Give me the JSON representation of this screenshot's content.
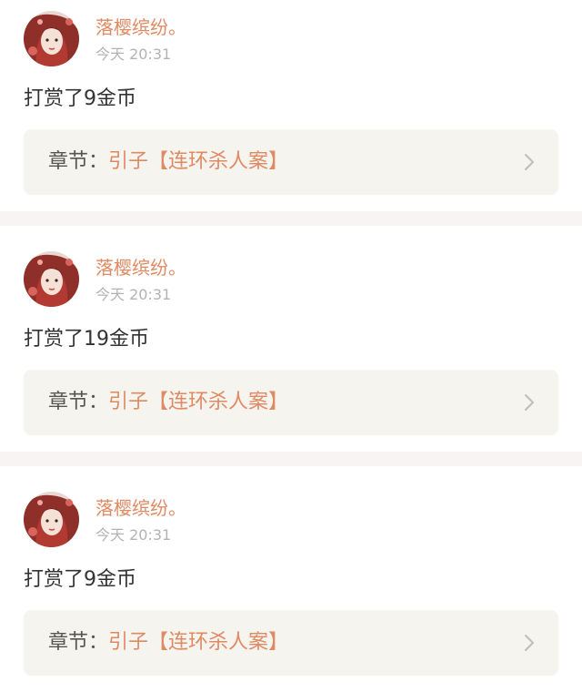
{
  "posts": [
    {
      "username": "落樱缤纷。",
      "time": "今天 20:31",
      "message": "打赏了9金币",
      "chapter_prefix": "章节：",
      "chapter_title": "引子【连环杀人案】"
    },
    {
      "username": "落樱缤纷。",
      "time": "今天 20:31",
      "message": "打赏了19金币",
      "chapter_prefix": "章节：",
      "chapter_title": "引子【连环杀人案】"
    },
    {
      "username": "落樱缤纷。",
      "time": "今天 20:31",
      "message": "打赏了9金币",
      "chapter_prefix": "章节：",
      "chapter_title": "引子【连环杀人案】"
    }
  ],
  "icons": {
    "avatar": "user-avatar-illustration",
    "chevron": "chevron-right-icon"
  },
  "colors": {
    "accent": "#e08a63",
    "time": "#b3b3b3",
    "chapter_box": "#f5f4ef",
    "separator": "#f7f4f3"
  }
}
